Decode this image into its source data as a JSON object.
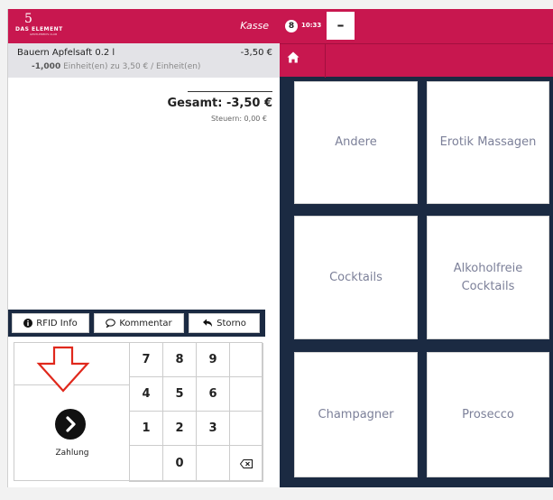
{
  "left_header": {
    "logo_five": "5",
    "logo_main": "DAS ELEMENT",
    "logo_sub": "GENTLEMEN'S CLUB",
    "register_label": "Kasse"
  },
  "order": {
    "item_name": "Bauern Apfelsaft 0.2 l",
    "item_price": "-3,50 €",
    "quantity": "-1,000",
    "detail": " Einheit(en) zu 3,50 € / Einheit(en)"
  },
  "totals": {
    "total": "Gesamt: -3,50 €",
    "tax": "Steuern: 0,00 €"
  },
  "actions": {
    "rfid_label": "RFID Info",
    "comment_label": "Kommentar",
    "cancel_label": "Storno"
  },
  "keypad": {
    "keys": [
      "7",
      "8",
      "9",
      "",
      "4",
      "5",
      "6",
      "",
      "1",
      "2",
      "3",
      "",
      "",
      "0",
      "",
      "⌫"
    ],
    "payment_label": "Zahlung"
  },
  "session": {
    "badge_count": "8",
    "time": "10:33",
    "minus_label": "–"
  },
  "categories": [
    "Andere",
    "Erotik Massagen",
    "Cocktails",
    "Alkoholfreie Cocktails",
    "Champagner",
    "Prosecco"
  ],
  "colors": {
    "brand": "#c8174f",
    "navy": "#1b2a42",
    "tile_text": "#7c8099",
    "annotation_arrow": "#e0281c"
  },
  "icons": {
    "rfid": "info-circle-icon",
    "comment": "speech-bubble-icon",
    "cancel": "undo-arrow-icon",
    "payment": "chevron-right-circle-icon",
    "home": "home-icon",
    "backspace": "backspace-icon",
    "annotation": "down-arrow-icon"
  }
}
